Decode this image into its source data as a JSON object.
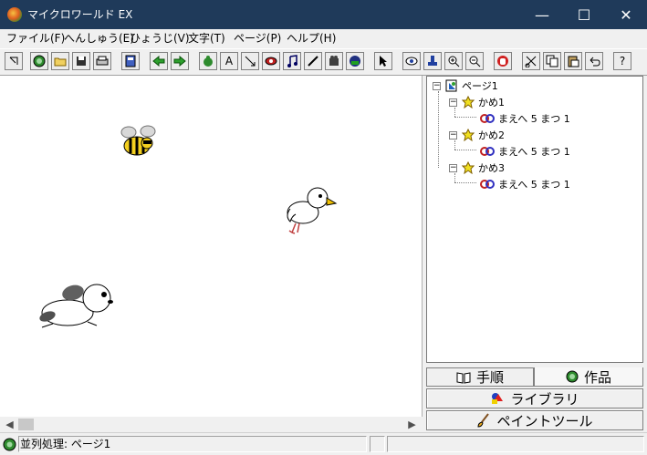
{
  "window": {
    "title": "マイクロワールド EX"
  },
  "window_controls": {
    "minimize": "—",
    "maximize": "☐",
    "close": "✕"
  },
  "menu": [
    "ファイル(F)",
    "へんしゅう(E)",
    "ひょうじ(V)",
    "文字(T)",
    "ページ(P)",
    "ヘルプ(H)"
  ],
  "toolbar": {
    "text_tool": "A",
    "help": "?"
  },
  "tree": {
    "root": "ページ1",
    "turtles": [
      {
        "name": "かめ1",
        "instruction": "まえへ 5 まつ 1"
      },
      {
        "name": "かめ2",
        "instruction": "まえへ 5 まつ 1"
      },
      {
        "name": "かめ3",
        "instruction": "まえへ 5 まつ 1"
      }
    ]
  },
  "tabs": {
    "procedures": "手順",
    "works": "作品"
  },
  "panel_buttons": {
    "library": "ライブラリ",
    "paint_tool": "ペイントツール"
  },
  "status": {
    "text": "並列処理: ページ1"
  },
  "colors": {
    "titlebar": "#1f3a5a",
    "accent_green": "#2e8b2e"
  }
}
